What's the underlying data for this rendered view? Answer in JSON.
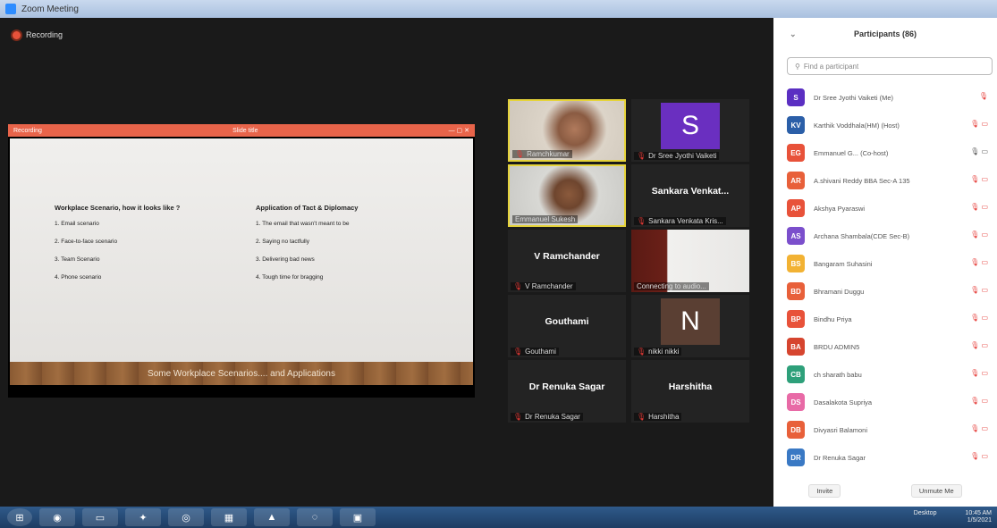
{
  "window": {
    "title": "Zoom Meeting"
  },
  "recording": {
    "label": "Recording"
  },
  "share": {
    "topbar_left": "Recording",
    "topbar_center": "Slide title",
    "left_heading": "Workplace Scenario, how it looks like ?",
    "left_items": [
      "1. Email scenario",
      "2. Face-to-face scenario",
      "3. Team Scenario",
      "4. Phone scenario"
    ],
    "right_heading": "Application of Tact & Diplomacy",
    "right_items": [
      "1. The email that wasn't meant to be",
      "2. Saying no tactfully",
      "3. Delivering bad news",
      "4. Tough time for bragging"
    ],
    "caption": "Some Workplace Scenarios.... and Applications"
  },
  "tiles": [
    {
      "name": "",
      "label": "Ramchkumar",
      "video": true
    },
    {
      "name": "",
      "label": "Dr Sree Jyothi Vaiketi",
      "avatar": "S",
      "avatar_color": "#6a2fc0"
    },
    {
      "name": "",
      "label": "Emmanuel Sukesh",
      "video": true
    },
    {
      "name": "Sankara Venkat...",
      "label": "Sankara Venkata Kris..."
    },
    {
      "name": "V Ramchander",
      "label": "V Ramchander"
    },
    {
      "name": "",
      "label": "Connecting to audio...",
      "video": true
    },
    {
      "name": "Gouthami",
      "label": "Gouthami"
    },
    {
      "name": "",
      "label": "nikki nikki",
      "avatar": "N",
      "avatar_color": "#5a3f33"
    },
    {
      "name": "Dr Renuka Sagar",
      "label": "Dr Renuka Sagar"
    },
    {
      "name": "Harshitha",
      "label": "Harshitha"
    }
  ],
  "panel": {
    "title": "Participants (86)",
    "search_placeholder": "Find a participant",
    "participants": [
      {
        "initials": "S",
        "color": "#5b2fc2",
        "name": "Dr Sree Jyothi Vaiketi (Me)"
      },
      {
        "initials": "KV",
        "color": "#2b5fa8",
        "name": "Karthik Voddhala(HM) (Host)"
      },
      {
        "initials": "EG",
        "color": "#e8523a",
        "name": "Emmanuel G... (Co-host)"
      },
      {
        "initials": "AR",
        "color": "#e8603a",
        "name": "A.shivani Reddy BBA Sec-A 135"
      },
      {
        "initials": "AP",
        "color": "#e8523a",
        "name": "Akshya Pyaraswi"
      },
      {
        "initials": "AS",
        "color": "#7b4fcc",
        "name": "Archana Shambala(CDE Sec-B)"
      },
      {
        "initials": "BS",
        "color": "#f2b233",
        "name": "Bangaram Suhasini"
      },
      {
        "initials": "BD",
        "color": "#e8603a",
        "name": "Bhramani Duggu"
      },
      {
        "initials": "BP",
        "color": "#e8523a",
        "name": "Bindhu Priya"
      },
      {
        "initials": "BA",
        "color": "#d6452f",
        "name": "BRDU ADMIN5"
      },
      {
        "initials": "CB",
        "color": "#2ea07a",
        "name": "ch sharath babu"
      },
      {
        "initials": "DS",
        "color": "#e86aa6",
        "name": "Dasalakota Supriya"
      },
      {
        "initials": "DB",
        "color": "#e8603a",
        "name": "Divyasri Balamoni"
      },
      {
        "initials": "DR",
        "color": "#3a79c4",
        "name": "Dr Renuka Sagar"
      }
    ],
    "invite_label": "Invite",
    "unmute_label": "Unmute Me"
  },
  "taskbar": {
    "tray_line1": "10:45 AM",
    "tray_line2": "1/5/2021",
    "desktop_label": "Desktop"
  }
}
